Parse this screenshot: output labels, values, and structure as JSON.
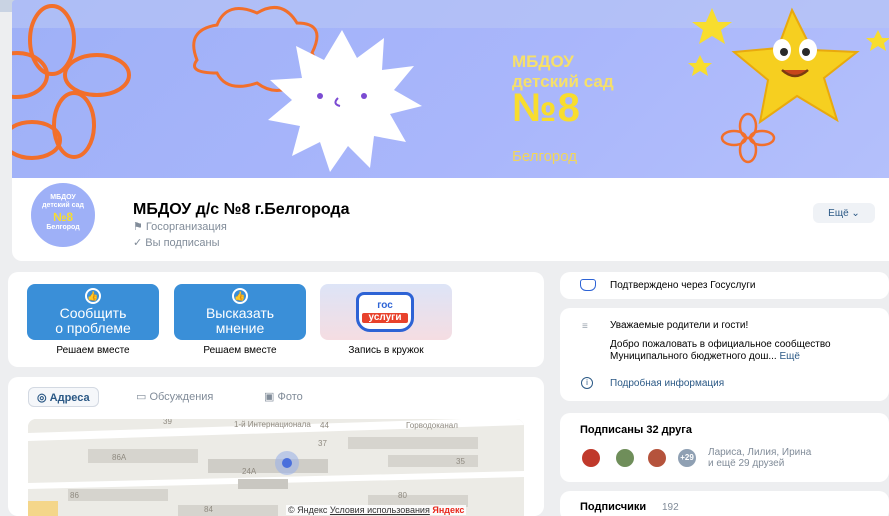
{
  "cover": {
    "title_line1": "МБДОУ",
    "title_line2": "детский сад",
    "number": "№8",
    "city": "Белгород",
    "colors": {
      "background": "#9eb0f7",
      "accent": "#f8dd2e",
      "sun": "#ffffff",
      "flower": "#f26f2b"
    }
  },
  "avatar": {
    "line1": "МБДОУ",
    "line2": "детский сад",
    "number": "№8",
    "city": "Белгород"
  },
  "profile": {
    "name": "МБДОУ д/с №8 г.Белгорода",
    "type": "Госорганизация",
    "subscribed": "Вы подписаны",
    "more_button": "Ещё"
  },
  "actions": [
    {
      "label_line1": "Сообщить",
      "label_line2": "о проблеме",
      "caption": "Решаем вместе",
      "icon": "thumbs-up-icon"
    },
    {
      "label_line1": "Высказать",
      "label_line2": "мнение",
      "caption": "Решаем вместе",
      "icon": "thumbs-up-icon"
    },
    {
      "logo_line1": "гос",
      "logo_line2": "услуги",
      "caption": "Запись в кружок",
      "icon": "gosuslugi-logo"
    }
  ],
  "tabs": [
    {
      "label": "Адреса",
      "icon": "location-icon",
      "active": true
    },
    {
      "label": "Обсуждения",
      "icon": "chat-icon",
      "active": false
    },
    {
      "label": "Фото",
      "icon": "photo-icon",
      "active": false
    }
  ],
  "map": {
    "labels": [
      "39",
      "44",
      "1-й Интернационала",
      "Горводоканал",
      "37",
      "86А",
      "24А",
      "35",
      "86",
      "80",
      "84"
    ],
    "footer_prefix": "© Яндекс",
    "footer_link": "Условия использования",
    "footer_brand": "Яндекс"
  },
  "sidebar": {
    "verify_text": "Подтверждено через Госуслуги",
    "welcome_title": "Уважаемые родители и гости!",
    "welcome_text": "Добро пожаловать в официальное сообщество Муниципального бюджетного дош...",
    "welcome_more": "Ещё",
    "info_link": "Подробная информация",
    "friends_title": "Подписаны 32 друга",
    "friends_badge": "+29",
    "friends_names_line1": "Лариса, Лилия, Ирина",
    "friends_names_line2": "и ещё 29 друзей",
    "subscribers_label": "Подписчики",
    "subscribers_count": "192"
  }
}
